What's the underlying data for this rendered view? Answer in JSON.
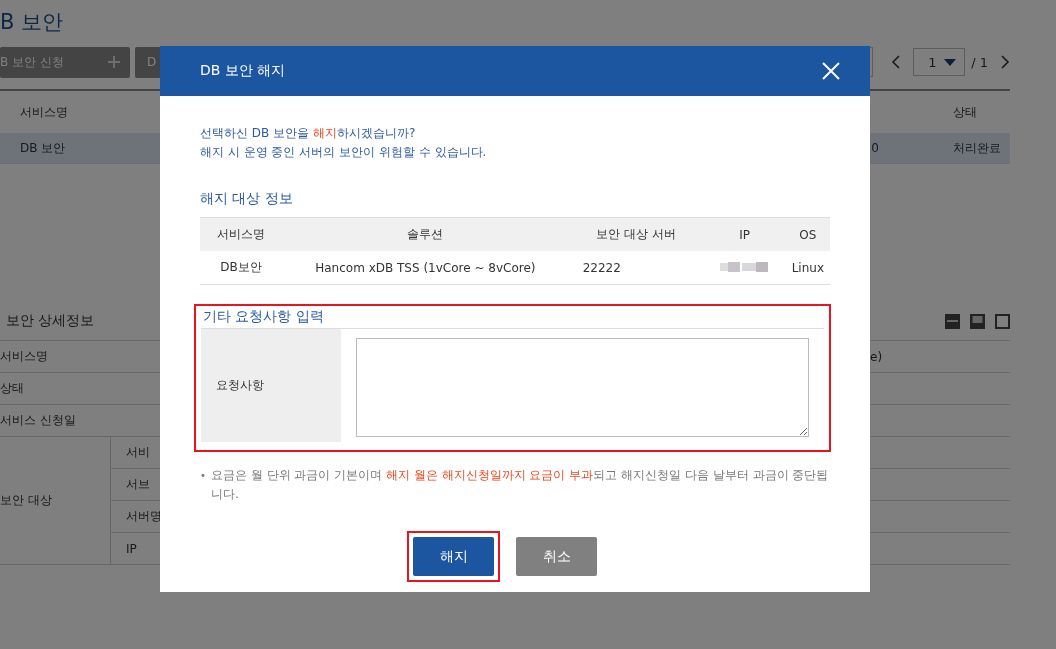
{
  "page": {
    "title": "B 보안",
    "toolbar": [
      {
        "label": "B 보안 신청",
        "kind": "add"
      },
      {
        "label": "D",
        "kind": "plain"
      }
    ],
    "pager": {
      "page": "1",
      "total": "/ 1"
    },
    "list": {
      "columns": [
        "서비스명",
        "",
        "상태"
      ],
      "rows": [
        {
          "cells": [
            "DB 보안",
            "0",
            "처리완료"
          ],
          "selected": true
        }
      ]
    },
    "detail": {
      "title": "보안 상세정보",
      "rows": [
        {
          "label": "서비스명",
          "value": "e)"
        },
        {
          "label": "상태"
        },
        {
          "label": "서비스 신청일"
        }
      ],
      "group": {
        "label": "보안 대상",
        "sub_labels": [
          "서비",
          "서브",
          "서버명",
          "IP"
        ]
      }
    }
  },
  "dialog": {
    "title": "DB 보안 해지",
    "message": [
      [
        {
          "text": "선택하신 DB 보안을 ",
          "emphasis": false
        },
        {
          "text": "해지",
          "emphasis": true
        },
        {
          "text": "하시겠습니까?",
          "emphasis": false
        }
      ],
      [
        {
          "text": "해지 시 운영 중인 서버의 보안이 위험할 수 있습니다.",
          "emphasis": false
        }
      ]
    ],
    "target_title": "해지 대상 정보",
    "target_table": {
      "columns": [
        "서비스명",
        "솔루션",
        "보안 대상 서버",
        "IP",
        "OS"
      ],
      "rows": [
        [
          {
            "text": "DB보안"
          },
          {
            "text": "Hancom xDB TSS (1vCore ~ 8vCore)"
          },
          {
            "text": "22222"
          },
          {
            "kind": "redacted"
          },
          {
            "text": "Linux"
          }
        ]
      ]
    },
    "request": {
      "title": "기타 요청사항 입력",
      "label": "요청사항",
      "highlighted": true
    },
    "note_bullet": "•",
    "note": [
      {
        "text": "요금은 월 단위 과금이 기본이며 ",
        "emphasis": false
      },
      {
        "text": "해지 월은 해지신청일까지 요금이 부과",
        "emphasis": true
      },
      {
        "text": "되고 해지신청일 다음 날부터 과금이 중단됩니다.",
        "emphasis": false
      }
    ],
    "buttons": [
      {
        "label": "해지",
        "kind": "primary",
        "highlighted": true
      },
      {
        "label": "취소",
        "kind": "secondary",
        "highlighted": false
      }
    ]
  }
}
